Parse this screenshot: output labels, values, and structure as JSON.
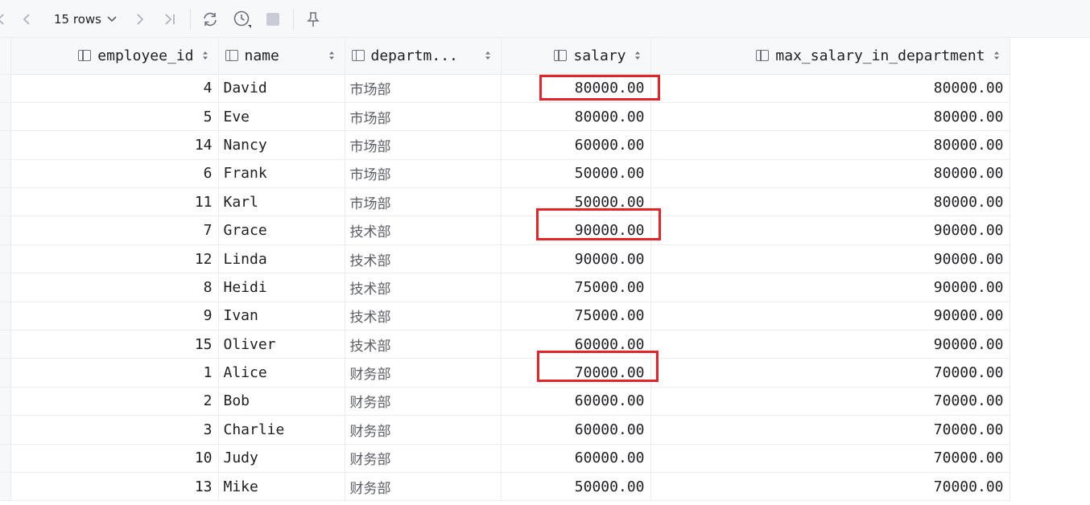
{
  "toolbar": {
    "rows_label": "15 rows",
    "icons": [
      "chevron-left-icon",
      "chevron-left-icon",
      "chevron-right-icon",
      "last-page-icon",
      "refresh-icon",
      "history-icon",
      "stop-icon",
      "pin-icon"
    ]
  },
  "table": {
    "columns": [
      {
        "label": "employee_id"
      },
      {
        "label": "name"
      },
      {
        "label": "departm..."
      },
      {
        "label": "salary"
      },
      {
        "label": "max_salary_in_department"
      }
    ],
    "rows": [
      {
        "employee_id": "4",
        "name": "David",
        "department": "市场部",
        "salary": "80000.00",
        "max_salary": "80000.00"
      },
      {
        "employee_id": "5",
        "name": "Eve",
        "department": "市场部",
        "salary": "80000.00",
        "max_salary": "80000.00"
      },
      {
        "employee_id": "14",
        "name": "Nancy",
        "department": "市场部",
        "salary": "60000.00",
        "max_salary": "80000.00"
      },
      {
        "employee_id": "6",
        "name": "Frank",
        "department": "市场部",
        "salary": "50000.00",
        "max_salary": "80000.00"
      },
      {
        "employee_id": "11",
        "name": "Karl",
        "department": "市场部",
        "salary": "50000.00",
        "max_salary": "80000.00"
      },
      {
        "employee_id": "7",
        "name": "Grace",
        "department": "技术部",
        "salary": "90000.00",
        "max_salary": "90000.00"
      },
      {
        "employee_id": "12",
        "name": "Linda",
        "department": "技术部",
        "salary": "90000.00",
        "max_salary": "90000.00"
      },
      {
        "employee_id": "8",
        "name": "Heidi",
        "department": "技术部",
        "salary": "75000.00",
        "max_salary": "90000.00"
      },
      {
        "employee_id": "9",
        "name": "Ivan",
        "department": "技术部",
        "salary": "75000.00",
        "max_salary": "90000.00"
      },
      {
        "employee_id": "15",
        "name": "Oliver",
        "department": "技术部",
        "salary": "60000.00",
        "max_salary": "90000.00"
      },
      {
        "employee_id": "1",
        "name": "Alice",
        "department": "财务部",
        "salary": "70000.00",
        "max_salary": "70000.00"
      },
      {
        "employee_id": "2",
        "name": "Bob",
        "department": "财务部",
        "salary": "60000.00",
        "max_salary": "70000.00"
      },
      {
        "employee_id": "3",
        "name": "Charlie",
        "department": "财务部",
        "salary": "60000.00",
        "max_salary": "70000.00"
      },
      {
        "employee_id": "10",
        "name": "Judy",
        "department": "财务部",
        "salary": "60000.00",
        "max_salary": "70000.00"
      },
      {
        "employee_id": "13",
        "name": "Mike",
        "department": "财务部",
        "salary": "50000.00",
        "max_salary": "70000.00"
      }
    ]
  },
  "highlight_color": "#e3242b"
}
